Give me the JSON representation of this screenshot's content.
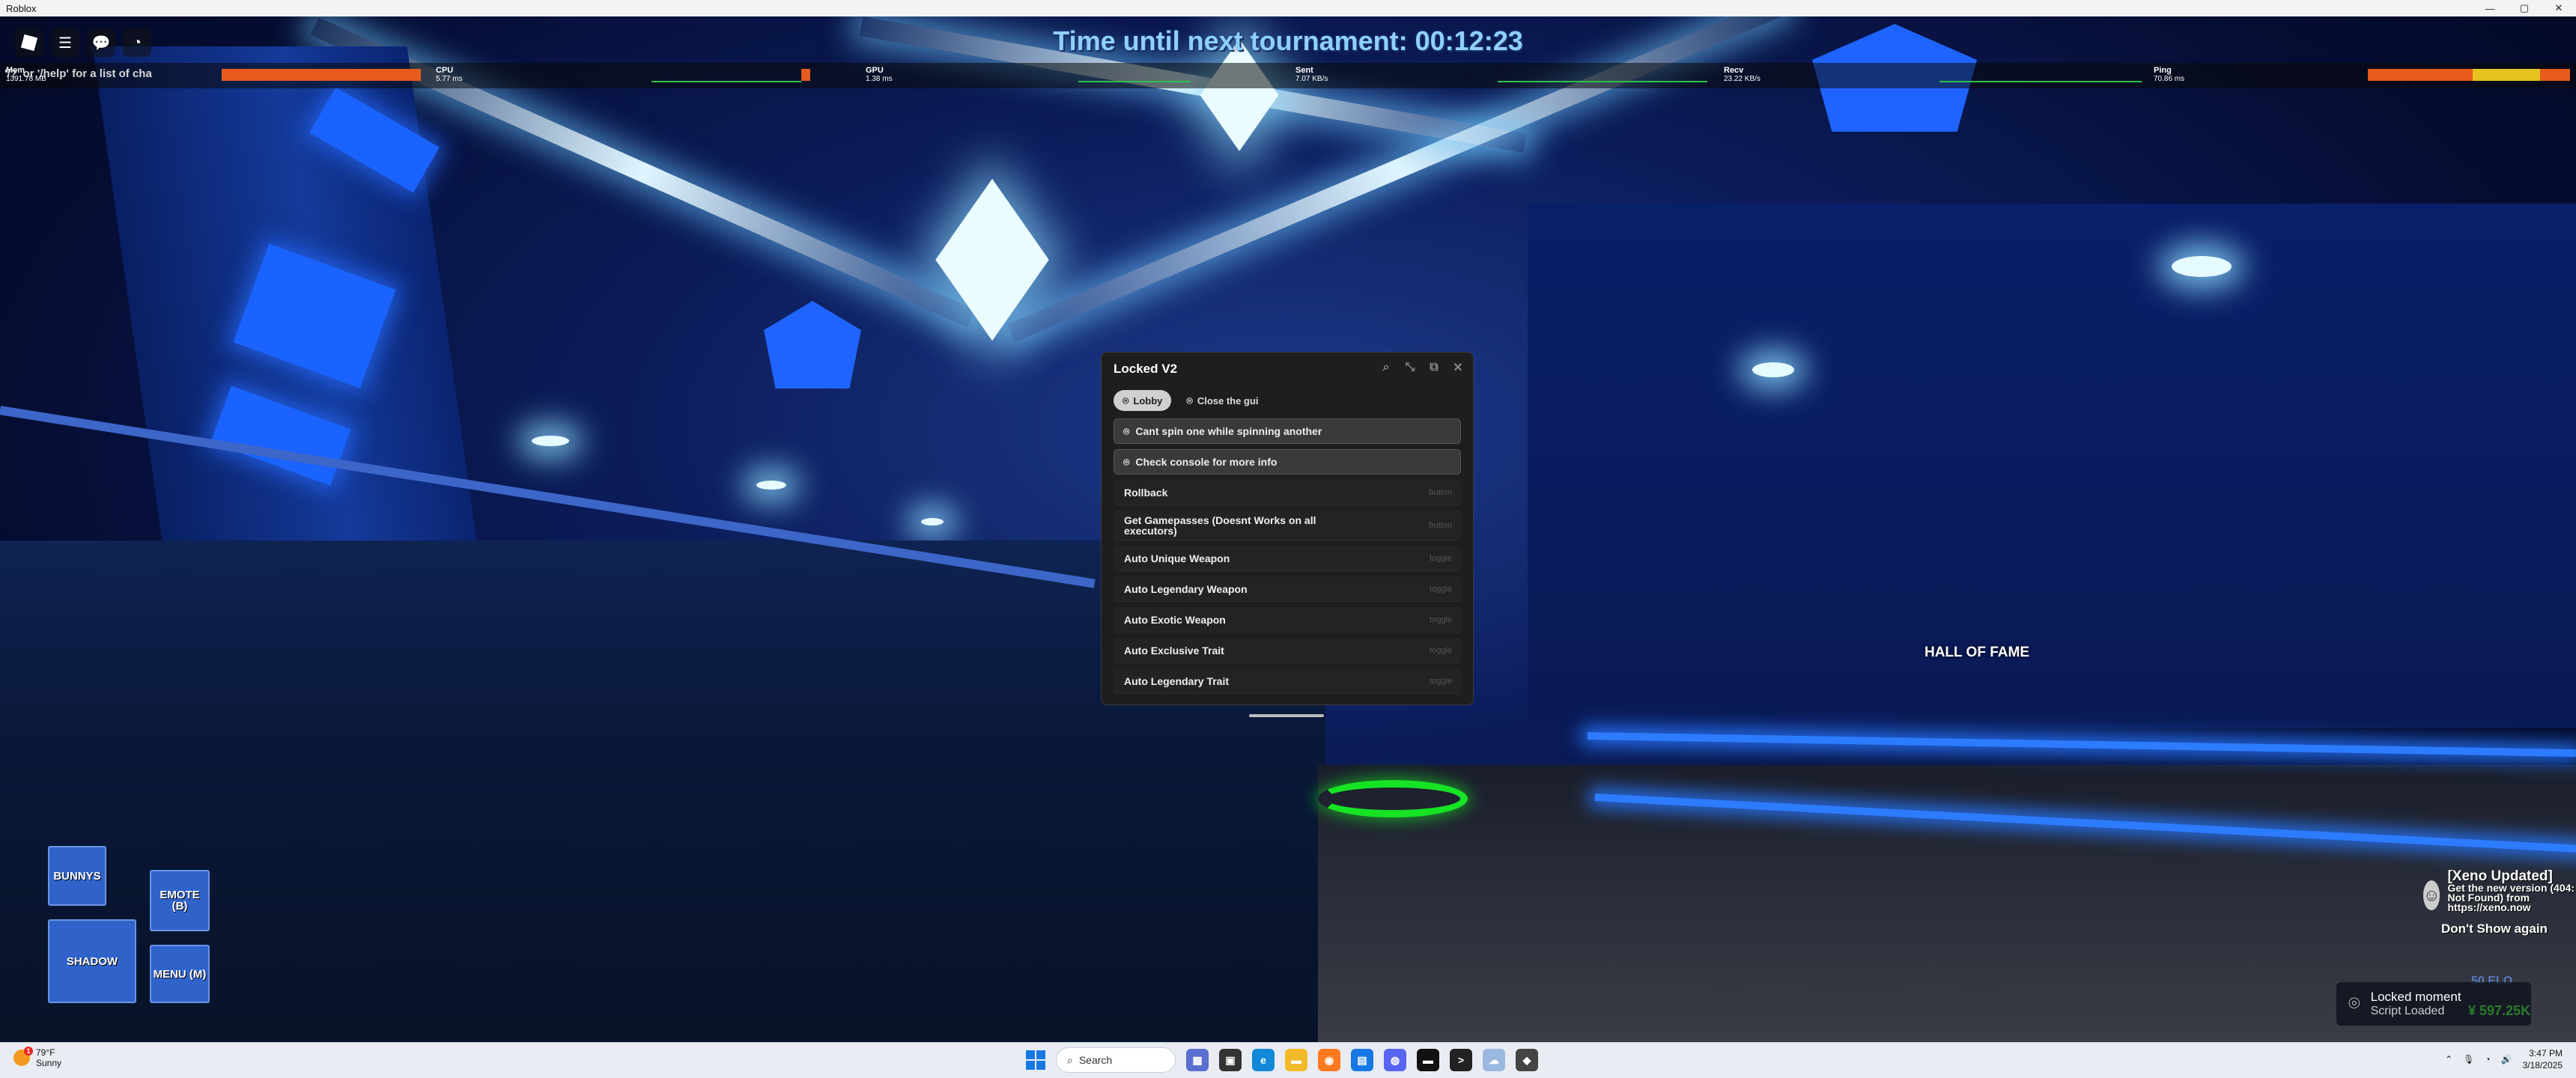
{
  "window": {
    "title": "Roblox",
    "min": "—",
    "max": "▢",
    "close": "✕"
  },
  "hud": {
    "tournament": "Time until next tournament: 00:12:23",
    "chat_hint": "'/?' or '/help' for a list of cha",
    "stats": {
      "mem_label": "Mem",
      "mem_value": "1391.78 MB",
      "cpu_label": "CPU",
      "cpu_value": "5.77 ms",
      "gpu_label": "GPU",
      "gpu_value": "1.38 ms",
      "sent_label": "Sent",
      "sent_value": "7.07 KB/s",
      "recv_label": "Recv",
      "recv_value": "23.22 KB/s",
      "ping_label": "Ping",
      "ping_value": "70.86 ms"
    },
    "icons": {
      "logo": "roblox-logo-icon",
      "menu": "☰",
      "chat": "💬",
      "perf": "◔"
    }
  },
  "gui": {
    "title": "Locked V2",
    "tools": [
      "⌕",
      "⤡",
      "⧉",
      "✕"
    ],
    "tabs": [
      {
        "label": "Lobby",
        "icon": "⌾"
      },
      {
        "label": "Close the gui",
        "icon": "⌾"
      }
    ],
    "paragraphs": [
      {
        "text": "Cant spin one while spinning another",
        "icon": "⌾"
      },
      {
        "text": "Check console for more info",
        "icon": "⌾"
      }
    ],
    "items": [
      {
        "label": "Rollback",
        "hint": "button"
      },
      {
        "label": "Get Gamepasses (Doesnt Works on all executors)",
        "hint": "button"
      },
      {
        "label": "Auto Unique Weapon",
        "hint": "toggle"
      },
      {
        "label": "Auto Legendary Weapon",
        "hint": "toggle"
      },
      {
        "label": "Auto Exotic Weapon",
        "hint": "toggle"
      },
      {
        "label": "Auto Exclusive Trait",
        "hint": "toggle"
      },
      {
        "label": "Auto Legendary Trait",
        "hint": "toggle"
      }
    ]
  },
  "scene": {
    "hall_of_fame": "HALL OF FAME"
  },
  "mobile": {
    "bunnys": "BUNNYS",
    "emote": "EMOTE (B)",
    "shadow": "SHADOW",
    "menu": "MENU (M)"
  },
  "xeno": {
    "title": "[Xeno Updated]",
    "message": "Get the new version (404: Not Found) from https://xeno.now",
    "dont_show": "Don't Show again"
  },
  "stats_corner": {
    "elo": "50 ELO",
    "money": "¥ 597.25K"
  },
  "toast": {
    "title": "Locked moment",
    "subtitle": "Script Loaded"
  },
  "taskbar": {
    "weather_temp": "79°F",
    "weather_desc": "Sunny",
    "weather_badge": "1",
    "search_placeholder": "Search",
    "time": "3:47 PM",
    "date": "3/18/2025"
  },
  "colors": {
    "accent": "#2d7bff",
    "gui_bg": "#1e1e1e",
    "stat_bar": "#e65a1e"
  }
}
